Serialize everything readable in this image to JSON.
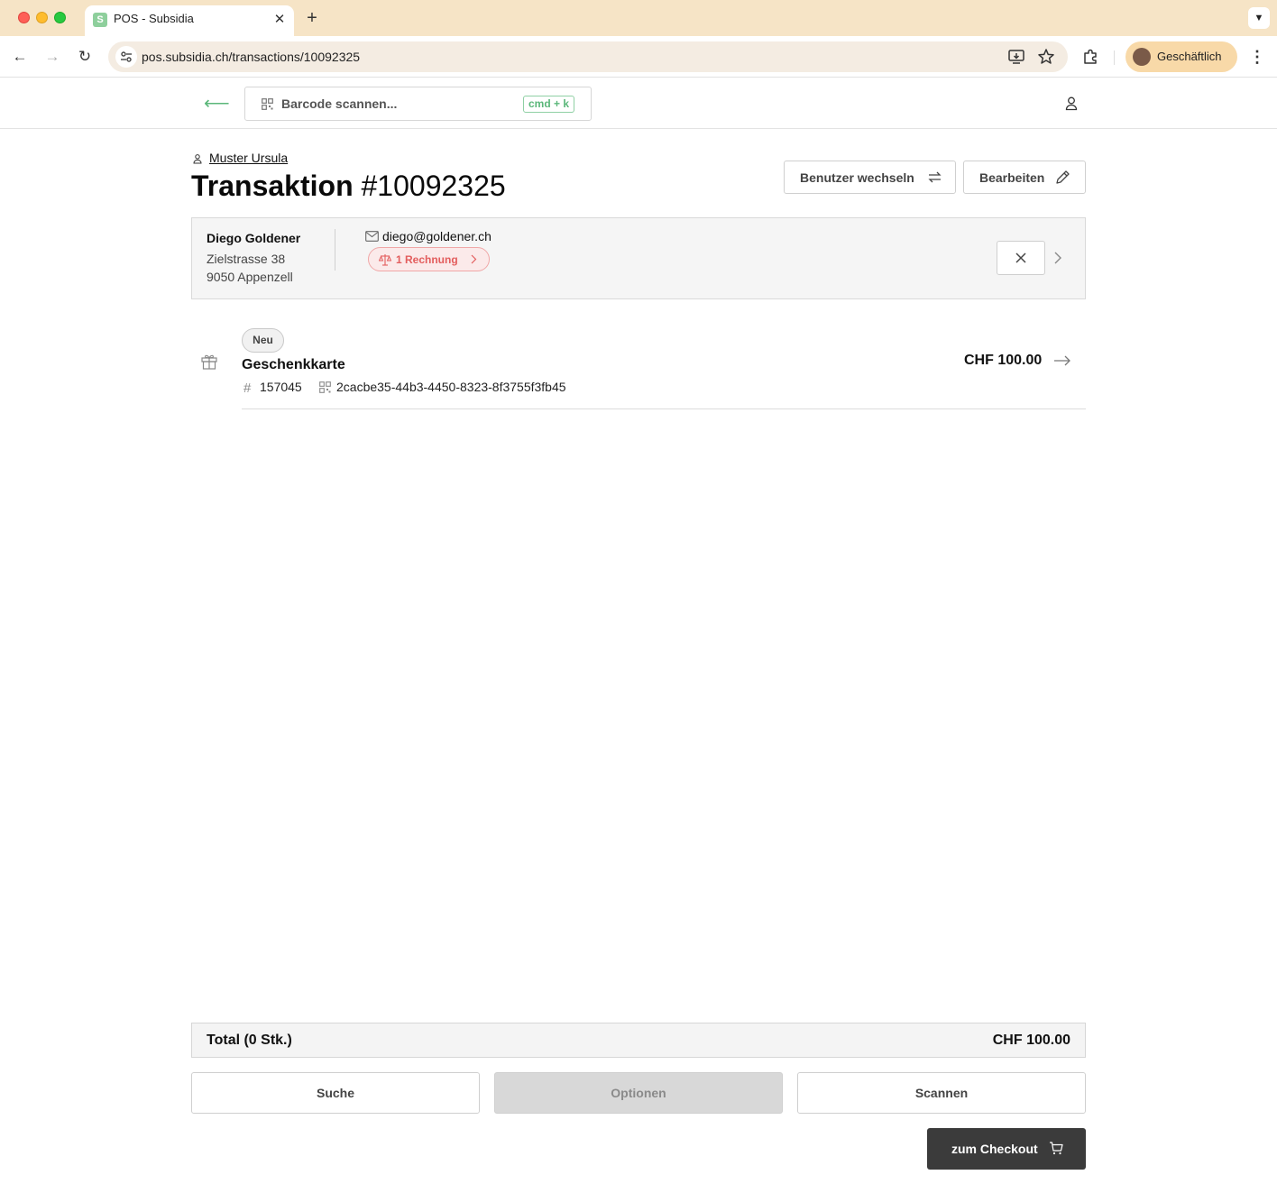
{
  "browser": {
    "tab_title": "POS - Subsidia",
    "tab_favicon": "S",
    "url": "pos.subsidia.ch/transactions/10092325",
    "profile_label": "Geschäftlich",
    "accent_color": "#f6e4c6"
  },
  "header": {
    "barcode_placeholder": "Barcode scannen...",
    "shortcut": "cmd + k",
    "accent_color": "#5bb77a"
  },
  "page": {
    "owner": "Muster Ursula",
    "title_label": "Transaktion",
    "title_number": "#10092325",
    "switch_user_label": "Benutzer wechseln",
    "edit_label": "Bearbeiten"
  },
  "customer": {
    "name": "Diego Goldener",
    "street": "Zielstrasse 38",
    "city": "9050 Appenzell",
    "email": "diego@goldener.ch",
    "invoice_badge": "1 Rechnung",
    "badge_color": "#e35d5d"
  },
  "items": [
    {
      "badge": "Neu",
      "title": "Geschenkkarte",
      "number": "157045",
      "code": "2cacbe35-44b3-4450-8323-8f3755f3fb45",
      "price": "CHF 100.00"
    }
  ],
  "footer": {
    "total_label": "Total (0 Stk.)",
    "total_value": "CHF 100.00",
    "search_label": "Suche",
    "options_label": "Optionen",
    "scan_label": "Scannen",
    "checkout_label": "zum Checkout"
  }
}
